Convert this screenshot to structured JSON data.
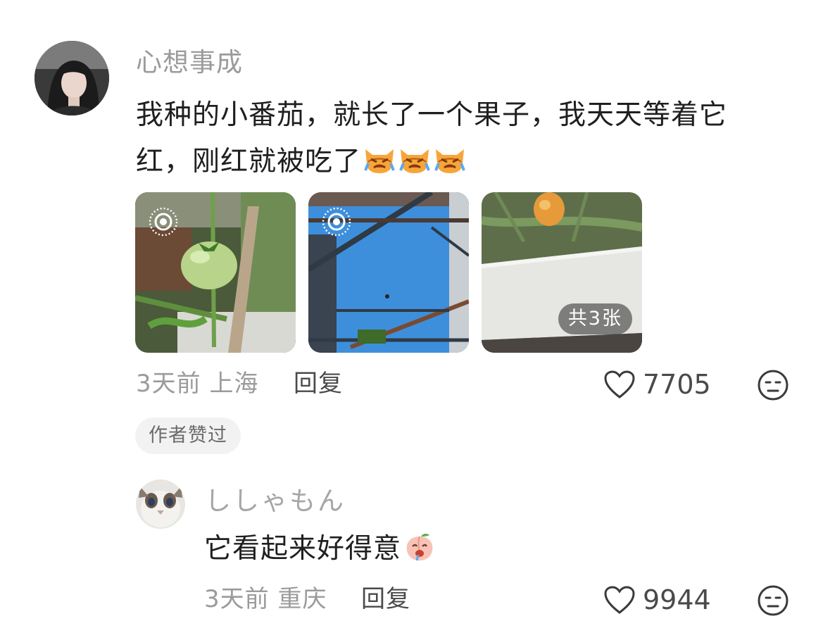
{
  "main_comment": {
    "username": "心想事成",
    "text": "我种的小番茄，就长了一个果子，我天天等着它红，刚红就被吃了",
    "emojis": [
      "crying-cat-emoji",
      "crying-cat-emoji",
      "crying-cat-emoji"
    ],
    "photos": [
      {
        "icon": "live-photo-icon",
        "subject": "green-tomato"
      },
      {
        "icon": "live-photo-icon",
        "subject": "sky-frame"
      },
      {
        "subject": "foam-planter",
        "badge": "共3张"
      }
    ],
    "time": "3天前",
    "location": "上海",
    "reply_label": "回复",
    "like_count": "7705",
    "author_liked_label": "作者赞过"
  },
  "reply_comment": {
    "username": "ししゃもん",
    "text": "它看起来好得意",
    "emoji": "drooling-peach-emoji",
    "time": "3天前",
    "location": "重庆",
    "reply_label": "回复",
    "like_count": "9944"
  },
  "colors": {
    "secondary_text": "#9b9b9b",
    "primary_text": "#1f1f1f",
    "badge_bg": "#f2f2f2"
  }
}
